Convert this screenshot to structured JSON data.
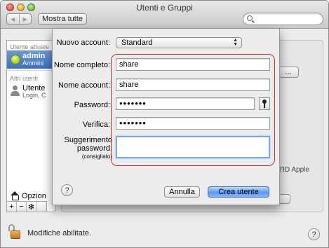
{
  "window": {
    "title": "Utenti e Gruppi",
    "nav_back": "◀",
    "nav_forward": "▶",
    "show_all": "Mostra tutte",
    "search_placeholder": ""
  },
  "sidebar": {
    "current_user_header": "Utente attuale",
    "current_user_name": "admin",
    "current_user_role": "Ammini",
    "other_users_header": "Altri utenti",
    "other_user_name": "Utente",
    "other_user_sub": "Login, C",
    "options_label": "Opzion",
    "add": "+",
    "remove": "−",
    "gear": "✻"
  },
  "background": {
    "right_button_label": "...",
    "apple_id_text": "l'ID Apple"
  },
  "footer": {
    "lock_label": "Modifiche abilitate.",
    "help": "?"
  },
  "sheet": {
    "new_account_label": "Nuovo account:",
    "new_account_value": "Standard",
    "full_name_label": "Nome completo:",
    "full_name_value": "share",
    "account_name_label": "Nome account:",
    "account_name_value": "share",
    "password_label": "Password:",
    "password_value": "•••••••",
    "verify_label": "Verifica:",
    "verify_value": "•••••••",
    "hint_label_1": "Suggerimento",
    "hint_label_2": "password:",
    "hint_label_3": "(consigliato)",
    "hint_value": "",
    "help": "?",
    "cancel": "Annulla",
    "create": "Crea utente"
  }
}
